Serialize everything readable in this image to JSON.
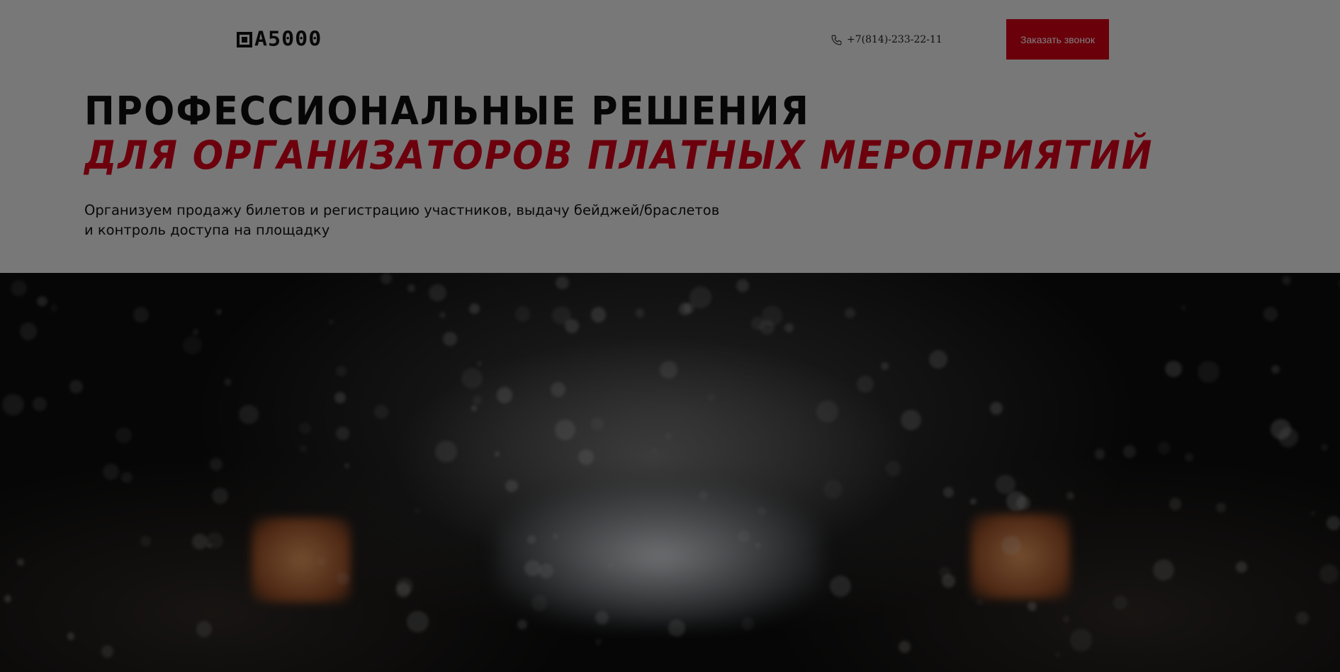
{
  "header": {
    "logo_text": "A5000",
    "phone_number": "+7(814)-233-22-11",
    "phone_icon": "phone-icon",
    "cta_label": "Заказать звонок"
  },
  "hero": {
    "title_line1": "Профессиональные решения",
    "title_line2": "для организаторов платных мероприятий",
    "subtitle_line1": "Организуем продажу билетов и регистрацию участников, выдачу бейджей/браслетов",
    "subtitle_line2": "и контроль доступа на площадку"
  },
  "colors": {
    "accent": "#d50014",
    "header_bg": "#f0f0f0",
    "overlay": "rgba(0,0,0,0.5)"
  }
}
